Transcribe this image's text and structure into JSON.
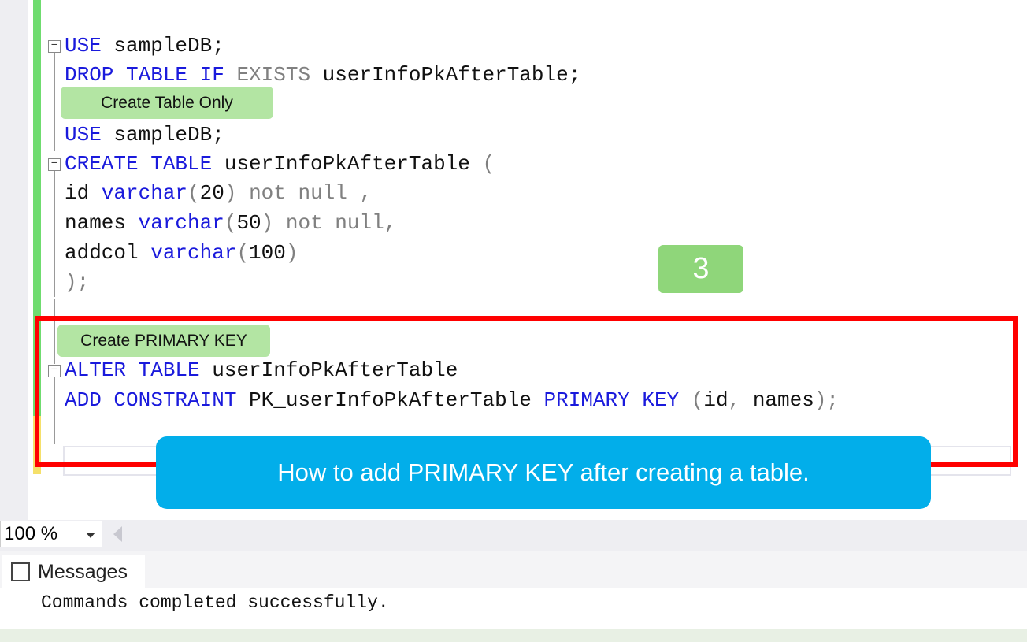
{
  "editor": {
    "lines": [
      [
        {
          "t": "USE",
          "c": "kw"
        },
        {
          "t": " sampleDB;",
          "c": "tx"
        }
      ],
      [
        {
          "t": "DROP TABLE IF",
          "c": "kw"
        },
        {
          "t": " EXISTS",
          "c": "gr"
        },
        {
          "t": " userInfoPkAfterTable;",
          "c": "tx"
        }
      ],
      [
        {
          "t": "USE",
          "c": "kw"
        },
        {
          "t": " sampleDB;",
          "c": "tx"
        }
      ],
      [
        {
          "t": "CREATE TABLE",
          "c": "kw"
        },
        {
          "t": " userInfoPkAfterTable ",
          "c": "tx"
        },
        {
          "t": "(",
          "c": "gr"
        }
      ],
      [
        {
          "t": "id ",
          "c": "tx"
        },
        {
          "t": "varchar",
          "c": "kw"
        },
        {
          "t": "(",
          "c": "gr"
        },
        {
          "t": "20",
          "c": "tx"
        },
        {
          "t": ") not null ,",
          "c": "gr"
        }
      ],
      [
        {
          "t": "names ",
          "c": "tx"
        },
        {
          "t": "varchar",
          "c": "kw"
        },
        {
          "t": "(",
          "c": "gr"
        },
        {
          "t": "50",
          "c": "tx"
        },
        {
          "t": ") not null,",
          "c": "gr"
        }
      ],
      [
        {
          "t": "addcol ",
          "c": "tx"
        },
        {
          "t": "varchar",
          "c": "kw"
        },
        {
          "t": "(",
          "c": "gr"
        },
        {
          "t": "100",
          "c": "tx"
        },
        {
          "t": ")",
          "c": "gr"
        }
      ],
      [
        {
          "t": ");",
          "c": "gr"
        }
      ],
      [
        {
          "t": "ALTER TABLE",
          "c": "kw"
        },
        {
          "t": " userInfoPkAfterTable",
          "c": "tx"
        }
      ],
      [
        {
          "t": "ADD CONSTRAINT",
          "c": "kw"
        },
        {
          "t": " PK_userInfoPkAfterTable ",
          "c": "tx"
        },
        {
          "t": "PRIMARY KEY",
          "c": "kw"
        },
        {
          "t": " (",
          "c": "gr"
        },
        {
          "t": "id",
          "c": "tx"
        },
        {
          "t": ", ",
          "c": "gr"
        },
        {
          "t": "names",
          "c": "tx"
        },
        {
          "t": ");",
          "c": "gr"
        }
      ]
    ]
  },
  "annotations": {
    "create_table_label": "Create Table Only",
    "create_pk_label": "Create PRIMARY KEY",
    "step_number": "3",
    "banner": "How to add PRIMARY KEY after creating a table."
  },
  "status": {
    "zoom": "100 %"
  },
  "results": {
    "tab_label": "Messages",
    "message": "Commands completed successfully."
  },
  "colors": {
    "keyword": "#1a1adc",
    "highlight_box": "#ff0000",
    "banner": "#02aeea",
    "tag": "#b3e5a3"
  }
}
